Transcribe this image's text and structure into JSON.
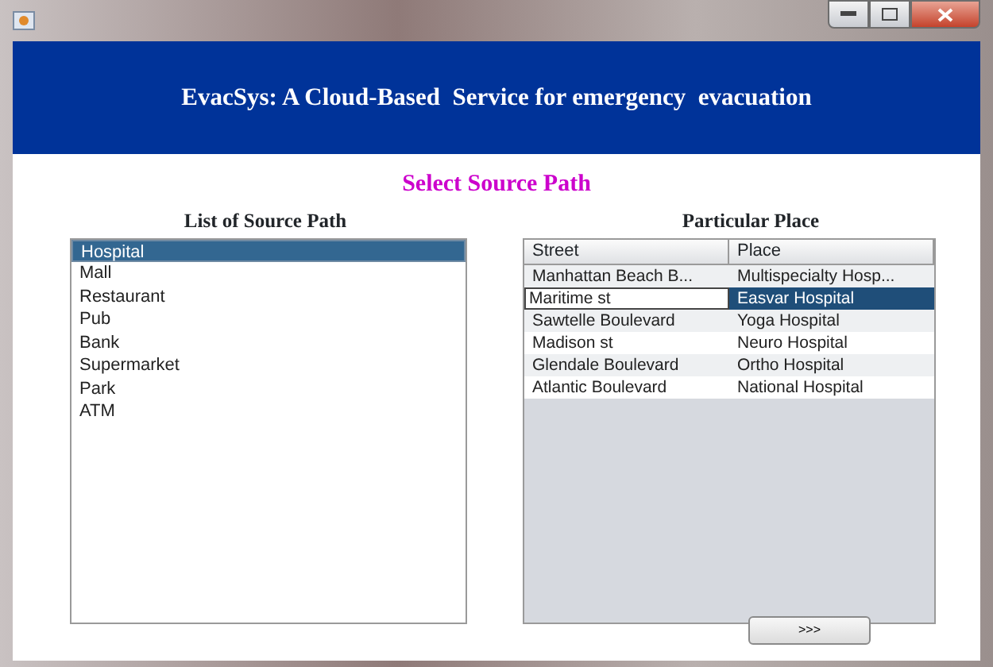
{
  "banner": {
    "title": "EvacSys: A Cloud-Based  Service for emergency  evacuation"
  },
  "heading": "Select Source Path",
  "source_list": {
    "title": "List of Source Path",
    "items": [
      {
        "label": "Hospital",
        "selected": true
      },
      {
        "label": "Mall",
        "selected": false
      },
      {
        "label": "Restaurant",
        "selected": false
      },
      {
        "label": "Pub",
        "selected": false
      },
      {
        "label": "Bank",
        "selected": false
      },
      {
        "label": "Supermarket",
        "selected": false
      },
      {
        "label": "Park",
        "selected": false
      },
      {
        "label": "ATM",
        "selected": false
      }
    ]
  },
  "places_table": {
    "title": "Particular Place",
    "columns": [
      "Street",
      "Place"
    ],
    "rows": [
      {
        "cells": [
          "Manhattan Beach B...",
          "Multispecialty Hosp..."
        ],
        "selected": false,
        "editing": false
      },
      {
        "cells": [
          "Maritime st",
          "Easvar Hospital"
        ],
        "selected": true,
        "editing": true
      },
      {
        "cells": [
          "Sawtelle Boulevard",
          "Yoga Hospital"
        ],
        "selected": false,
        "editing": false
      },
      {
        "cells": [
          "Madison st",
          "Neuro Hospital"
        ],
        "selected": false,
        "editing": false
      },
      {
        "cells": [
          "Glendale Boulevard",
          "Ortho Hospital"
        ],
        "selected": false,
        "editing": false
      },
      {
        "cells": [
          "Atlantic Boulevard",
          "National Hospital"
        ],
        "selected": false,
        "editing": false
      }
    ]
  },
  "next_button": ">>>"
}
